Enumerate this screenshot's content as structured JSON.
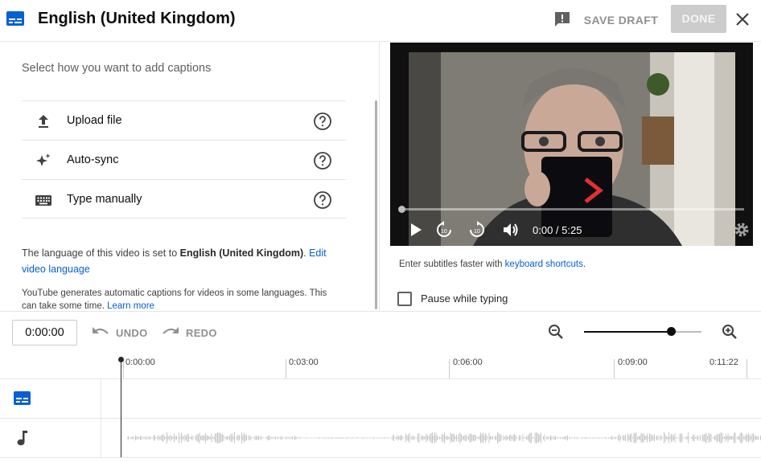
{
  "header": {
    "title": "English (United Kingdom)",
    "save_draft_label": "SAVE DRAFT",
    "done_label": "DONE"
  },
  "left": {
    "prompt": "Select how you want to add captions",
    "options": [
      {
        "label": "Upload file",
        "icon": "upload-icon"
      },
      {
        "label": "Auto-sync",
        "icon": "sparkle-icon"
      },
      {
        "label": "Type manually",
        "icon": "keyboard-icon"
      }
    ],
    "language_note": {
      "prefix": "The language of this video is set to ",
      "language": "English (United Kingdom)",
      "suffix": ". ",
      "link": "Edit video language"
    },
    "auto_note": {
      "text": "YouTube generates automatic captions for videos in some languages. This can take some time. ",
      "link": "Learn more"
    }
  },
  "player": {
    "timecode": "0:00 / 5:25",
    "progress": 0,
    "hint_prefix": "Enter subtitles faster with ",
    "hint_link": "keyboard shortcuts",
    "hint_suffix": ".",
    "pause_label": "Pause while typing",
    "pause_checked": false
  },
  "toolbar": {
    "time_value": "0:00:00",
    "undo_label": "UNDO",
    "redo_label": "REDO",
    "zoom_level": 0.75
  },
  "timeline": {
    "ticks": [
      "0:00:00",
      "0:03:00",
      "0:06:00",
      "0:09:00",
      "0:11:22"
    ]
  },
  "colors": {
    "accent": "#065fd4",
    "disabled": "#909090",
    "done_bg": "#cccccc"
  }
}
